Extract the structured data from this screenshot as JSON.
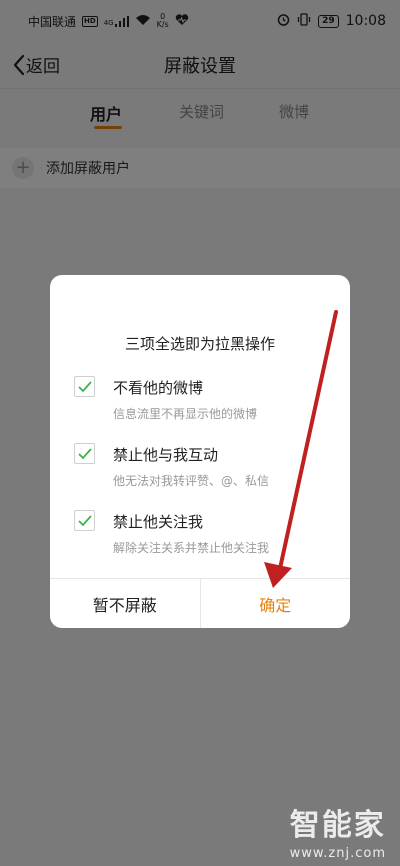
{
  "status_bar": {
    "carrier": "中国联通",
    "hd_badge": "HD",
    "net_type": "4G",
    "net_speed_value": "0",
    "net_speed_unit": "K/s",
    "battery": "29",
    "time": "10:08"
  },
  "nav": {
    "back_label": "返回",
    "title": "屏蔽设置"
  },
  "tabs": [
    {
      "label": "用户",
      "active": true
    },
    {
      "label": "关键词",
      "active": false
    },
    {
      "label": "微博",
      "active": false
    }
  ],
  "content": {
    "add_user_label": "添加屏蔽用户"
  },
  "dialog": {
    "title": "三项全选即为拉黑操作",
    "options": [
      {
        "label": "不看他的微博",
        "desc": "信息流里不再显示他的微博",
        "checked": true
      },
      {
        "label": "禁止他与我互动",
        "desc": "他无法对我转评赞、@、私信",
        "checked": true
      },
      {
        "label": "禁止他关注我",
        "desc": "解除关注关系并禁止他关注我",
        "checked": true
      }
    ],
    "cancel_label": "暂不屏蔽",
    "confirm_label": "确定"
  },
  "watermark": {
    "logo": "智能家",
    "url": "www.znj.com"
  },
  "colors": {
    "accent": "#e8820e",
    "check": "#3cb34a",
    "arrow": "#c0201f"
  }
}
